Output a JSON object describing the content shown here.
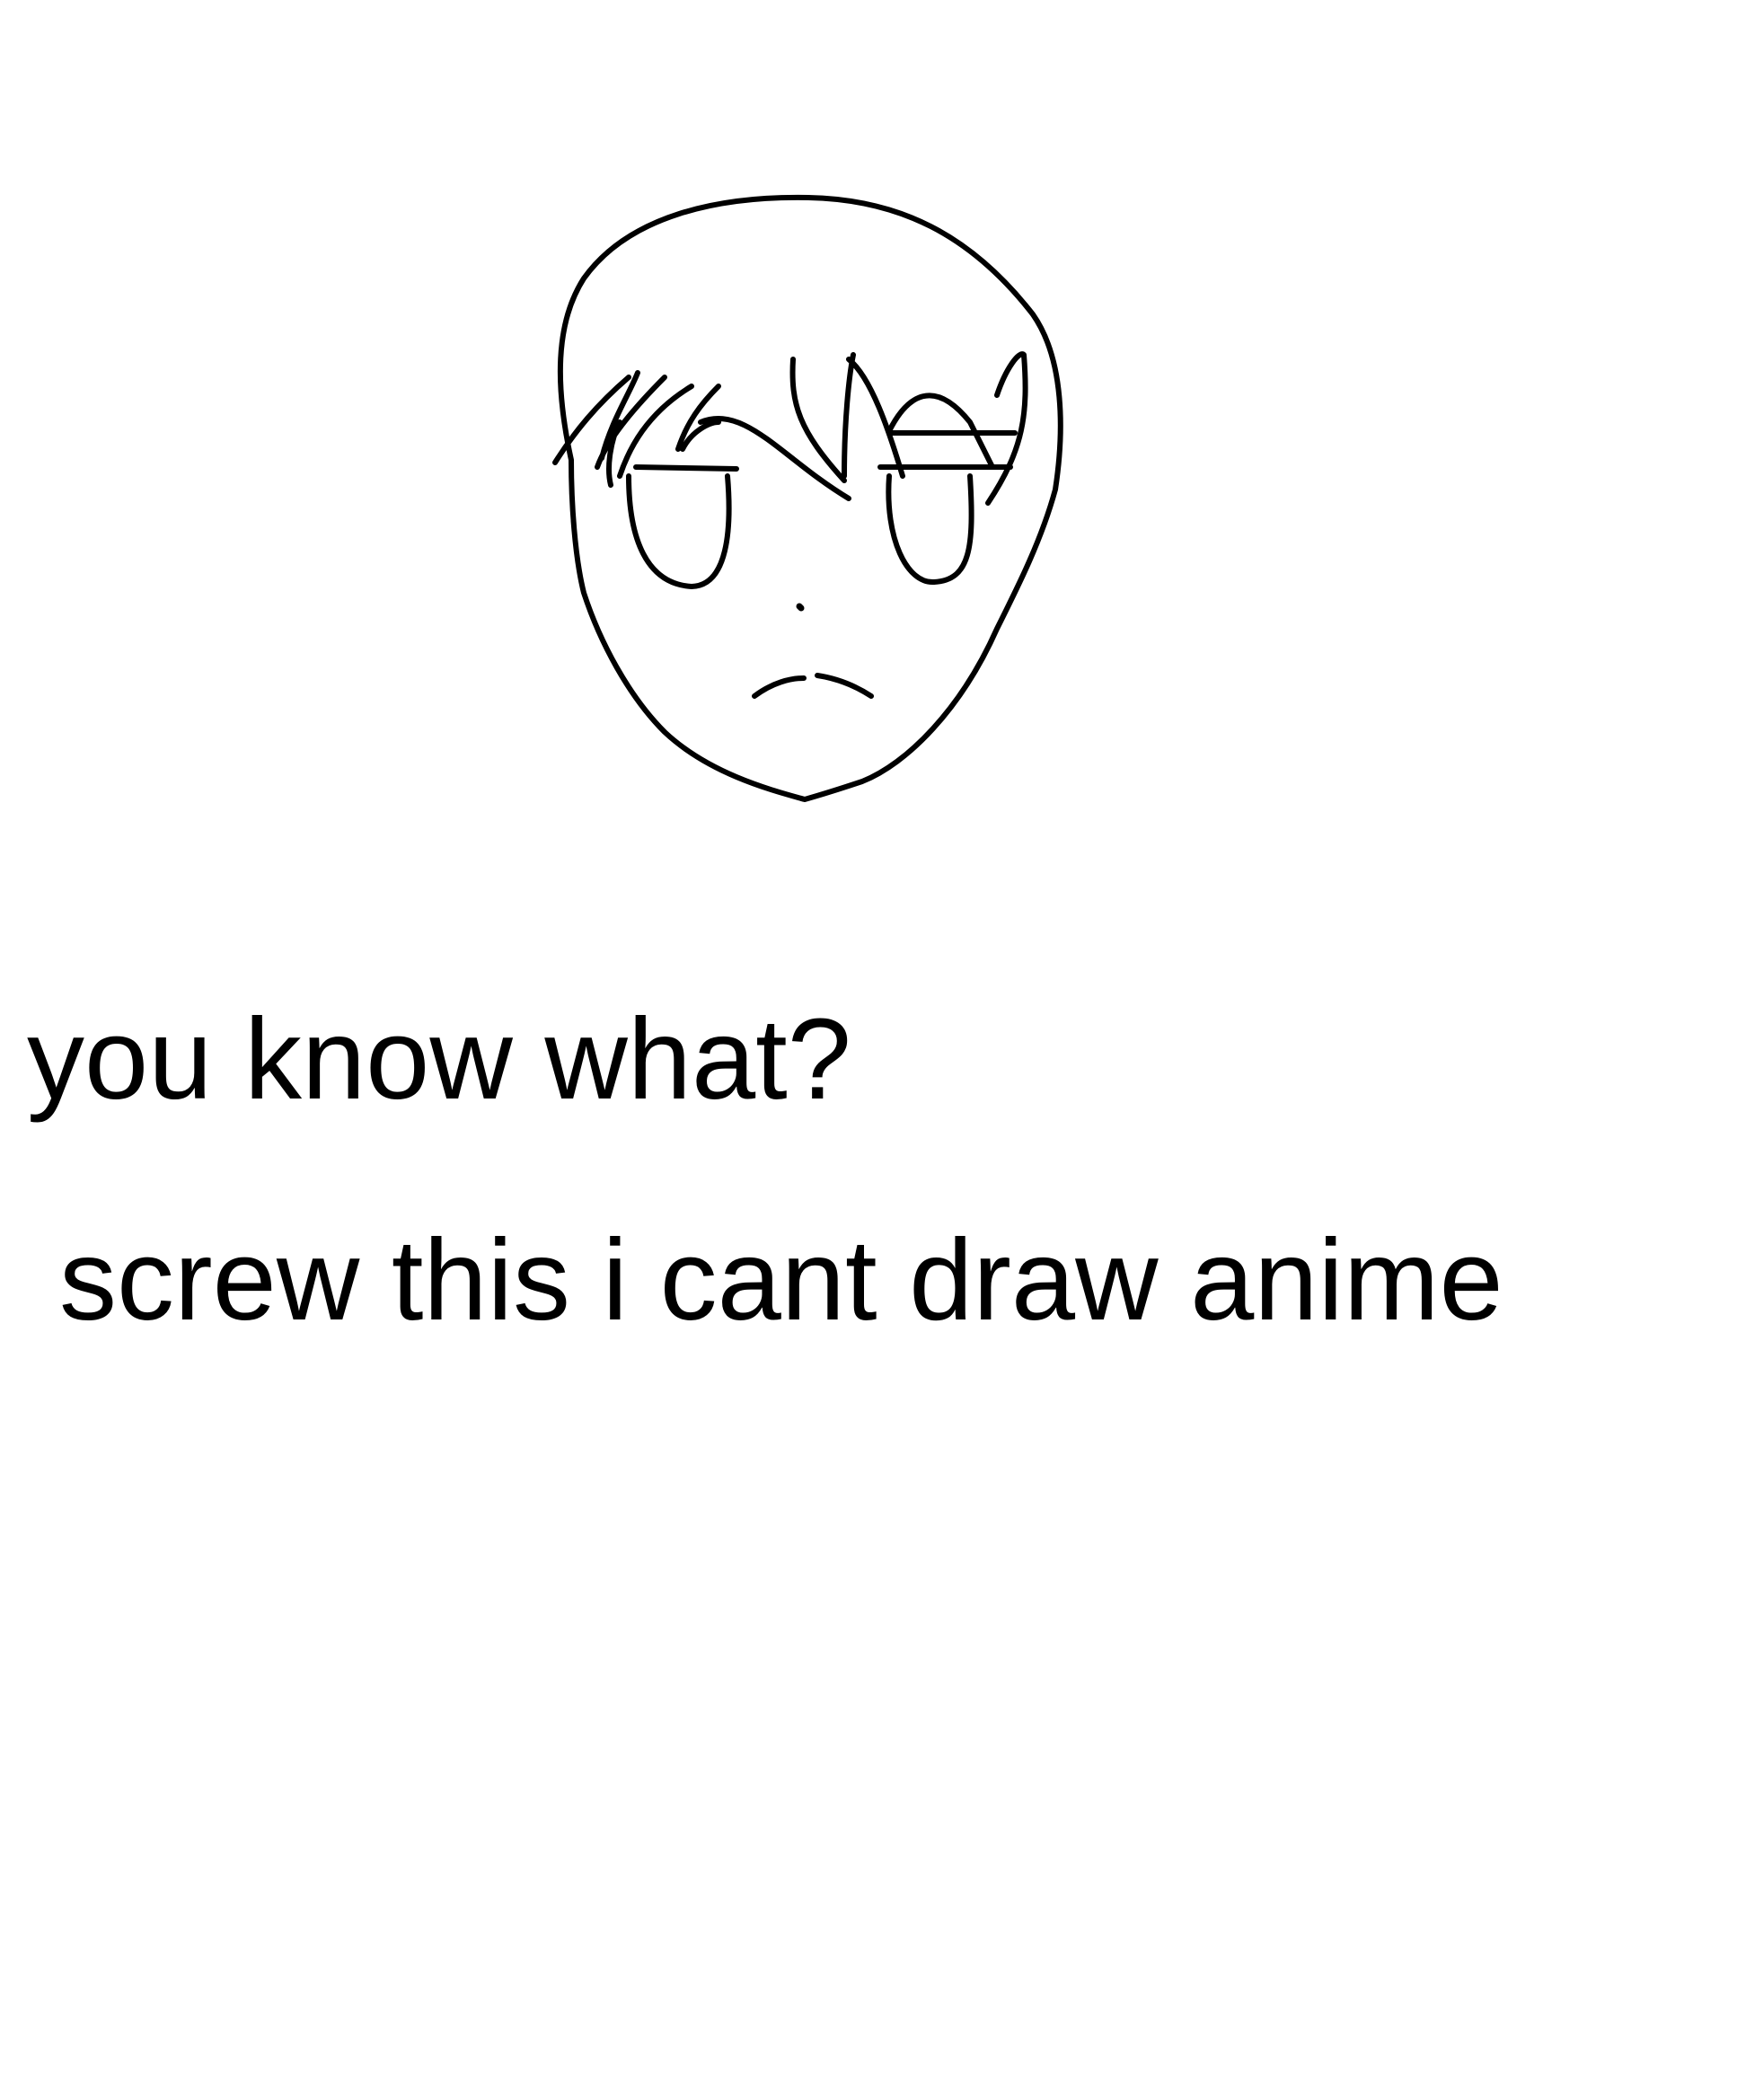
{
  "colors": {
    "background": "#ffffff",
    "ink": "#000000"
  },
  "drawing": {
    "subject": "face-sketch"
  },
  "captions": {
    "line1": "you know what?",
    "line2": "screw this i cant draw anime"
  }
}
